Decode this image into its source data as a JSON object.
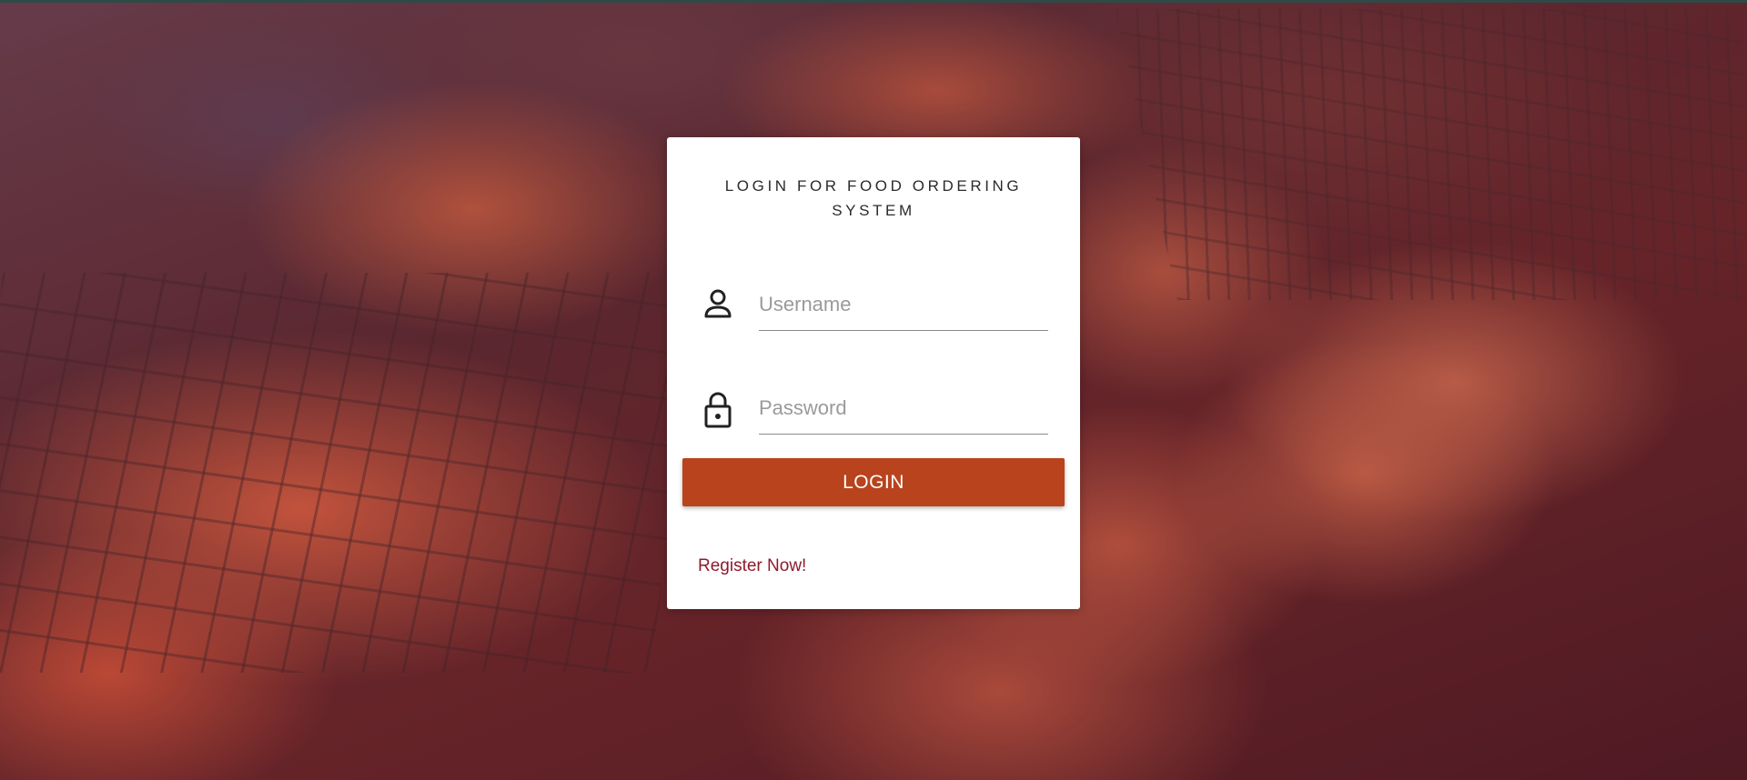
{
  "login_card": {
    "title": "LOGIN FOR FOOD ORDERING SYSTEM",
    "username": {
      "icon": "person-icon",
      "placeholder": "Username",
      "value": ""
    },
    "password": {
      "icon": "lock-icon",
      "placeholder": "Password",
      "value": ""
    },
    "login_label": "LOGIN",
    "register_label": "Register Now!"
  },
  "background": {
    "image": "grilled-meat-photo"
  },
  "colors": {
    "button": "#b8431c",
    "link": "#8e1b2a",
    "title_text": "#2b2b2b",
    "card": "#ffffff"
  }
}
